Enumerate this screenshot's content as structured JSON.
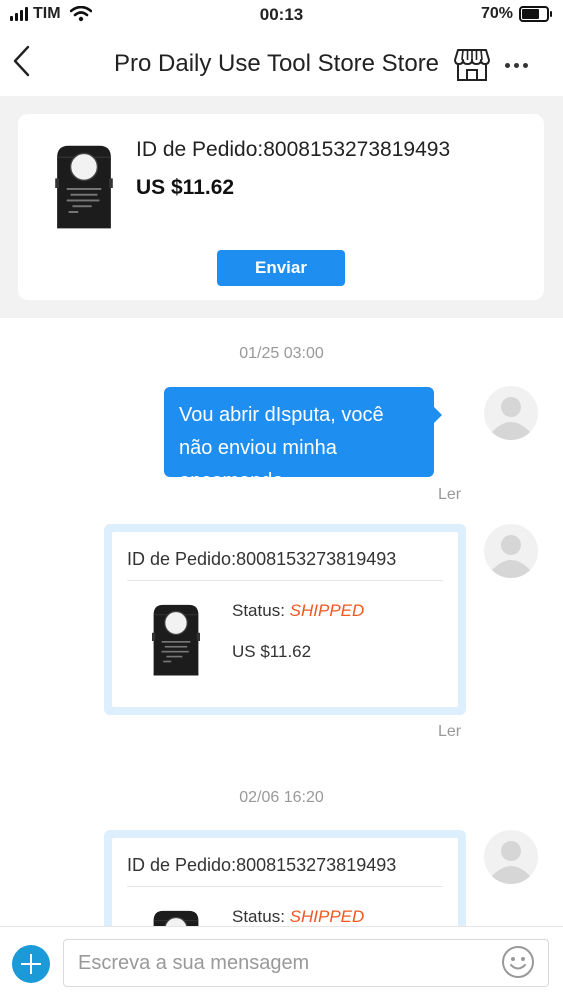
{
  "status_bar": {
    "carrier": "TIM",
    "time": "00:13",
    "battery": "70%",
    "battery_level": 0.7
  },
  "header": {
    "title": "Pro Daily Use Tool Store Store",
    "back_icon": "chevron-left-icon",
    "store_icon": "storefront-icon",
    "more_icon": "more-horizontal-icon"
  },
  "order_card": {
    "order_id": "ID de Pedido:8008153273819493",
    "price": "US $11.62",
    "send_label": "Enviar"
  },
  "chat": {
    "messages": [
      {
        "type": "timestamp",
        "text": "01/25 03:00"
      },
      {
        "type": "text",
        "sender": "me",
        "text": "Vou abrir dIsputa, você não enviou minha encomenda",
        "read_label": "Ler"
      },
      {
        "type": "order",
        "sender": "me",
        "order_id": "ID de Pedido:8008153273819493",
        "status_label": "Status:",
        "status_value": "SHIPPED",
        "price": "US $11.62",
        "read_label": "Ler"
      },
      {
        "type": "timestamp",
        "text": "02/06 16:20"
      },
      {
        "type": "order",
        "sender": "me",
        "order_id": "ID de Pedido:8008153273819493",
        "status_label": "Status:",
        "status_value": "SHIPPED"
      }
    ]
  },
  "input_bar": {
    "placeholder": "Escreva a sua mensagem",
    "add_icon": "plus-circle-icon",
    "emoji_icon": "emoji-smile-icon"
  },
  "colors": {
    "accent": "#1f8ef1",
    "status_shipped": "#f0581f",
    "add_button": "#1a9bd7"
  }
}
